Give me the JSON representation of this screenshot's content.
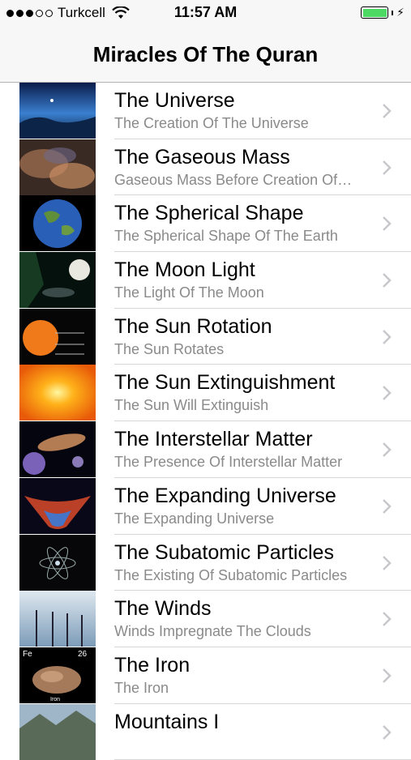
{
  "status_bar": {
    "carrier": "Turkcell",
    "time": "11:57 AM",
    "signal_bars_filled": 3,
    "signal_bars_total": 5,
    "battery_level": 1.0,
    "battery_color": "#4cd964"
  },
  "navbar": {
    "title": "Miracles Of The Quran"
  },
  "rows": [
    {
      "title": "The Universe",
      "subtitle": "The Creation Of The Universe",
      "icon": "universe-thumbnail"
    },
    {
      "title": "The Gaseous Mass",
      "subtitle": "Gaseous Mass Before Creation Of…",
      "icon": "nebula-thumbnail"
    },
    {
      "title": "The Spherical Shape",
      "subtitle": "The Spherical Shape Of The Earth",
      "icon": "earth-thumbnail"
    },
    {
      "title": "The Moon Light",
      "subtitle": "The Light Of The Moon",
      "icon": "moon-thumbnail"
    },
    {
      "title": "The Sun Rotation",
      "subtitle": "The Sun Rotates",
      "icon": "sun-rotation-thumbnail"
    },
    {
      "title": "The Sun Extinguishment",
      "subtitle": "The Sun Will Extinguish",
      "icon": "sun-thumbnail"
    },
    {
      "title": "The Interstellar Matter",
      "subtitle": "The Presence Of Interstellar Matter",
      "icon": "galaxy-thumbnail"
    },
    {
      "title": "The Expanding Universe",
      "subtitle": "The Expanding Universe",
      "icon": "expansion-thumbnail"
    },
    {
      "title": "The Subatomic Particles",
      "subtitle": "The Existing Of Subatomic Particles",
      "icon": "atom-thumbnail"
    },
    {
      "title": "The Winds",
      "subtitle": "Winds Impregnate The Clouds",
      "icon": "wind-turbines-thumbnail"
    },
    {
      "title": "The Iron",
      "subtitle": "The Iron",
      "icon": "iron-thumbnail"
    },
    {
      "title": "Mountains I",
      "subtitle": "",
      "icon": "mountains-thumbnail"
    }
  ],
  "iron_thumb_labels": {
    "symbol": "Fe",
    "number": "26",
    "name": "Iron"
  }
}
